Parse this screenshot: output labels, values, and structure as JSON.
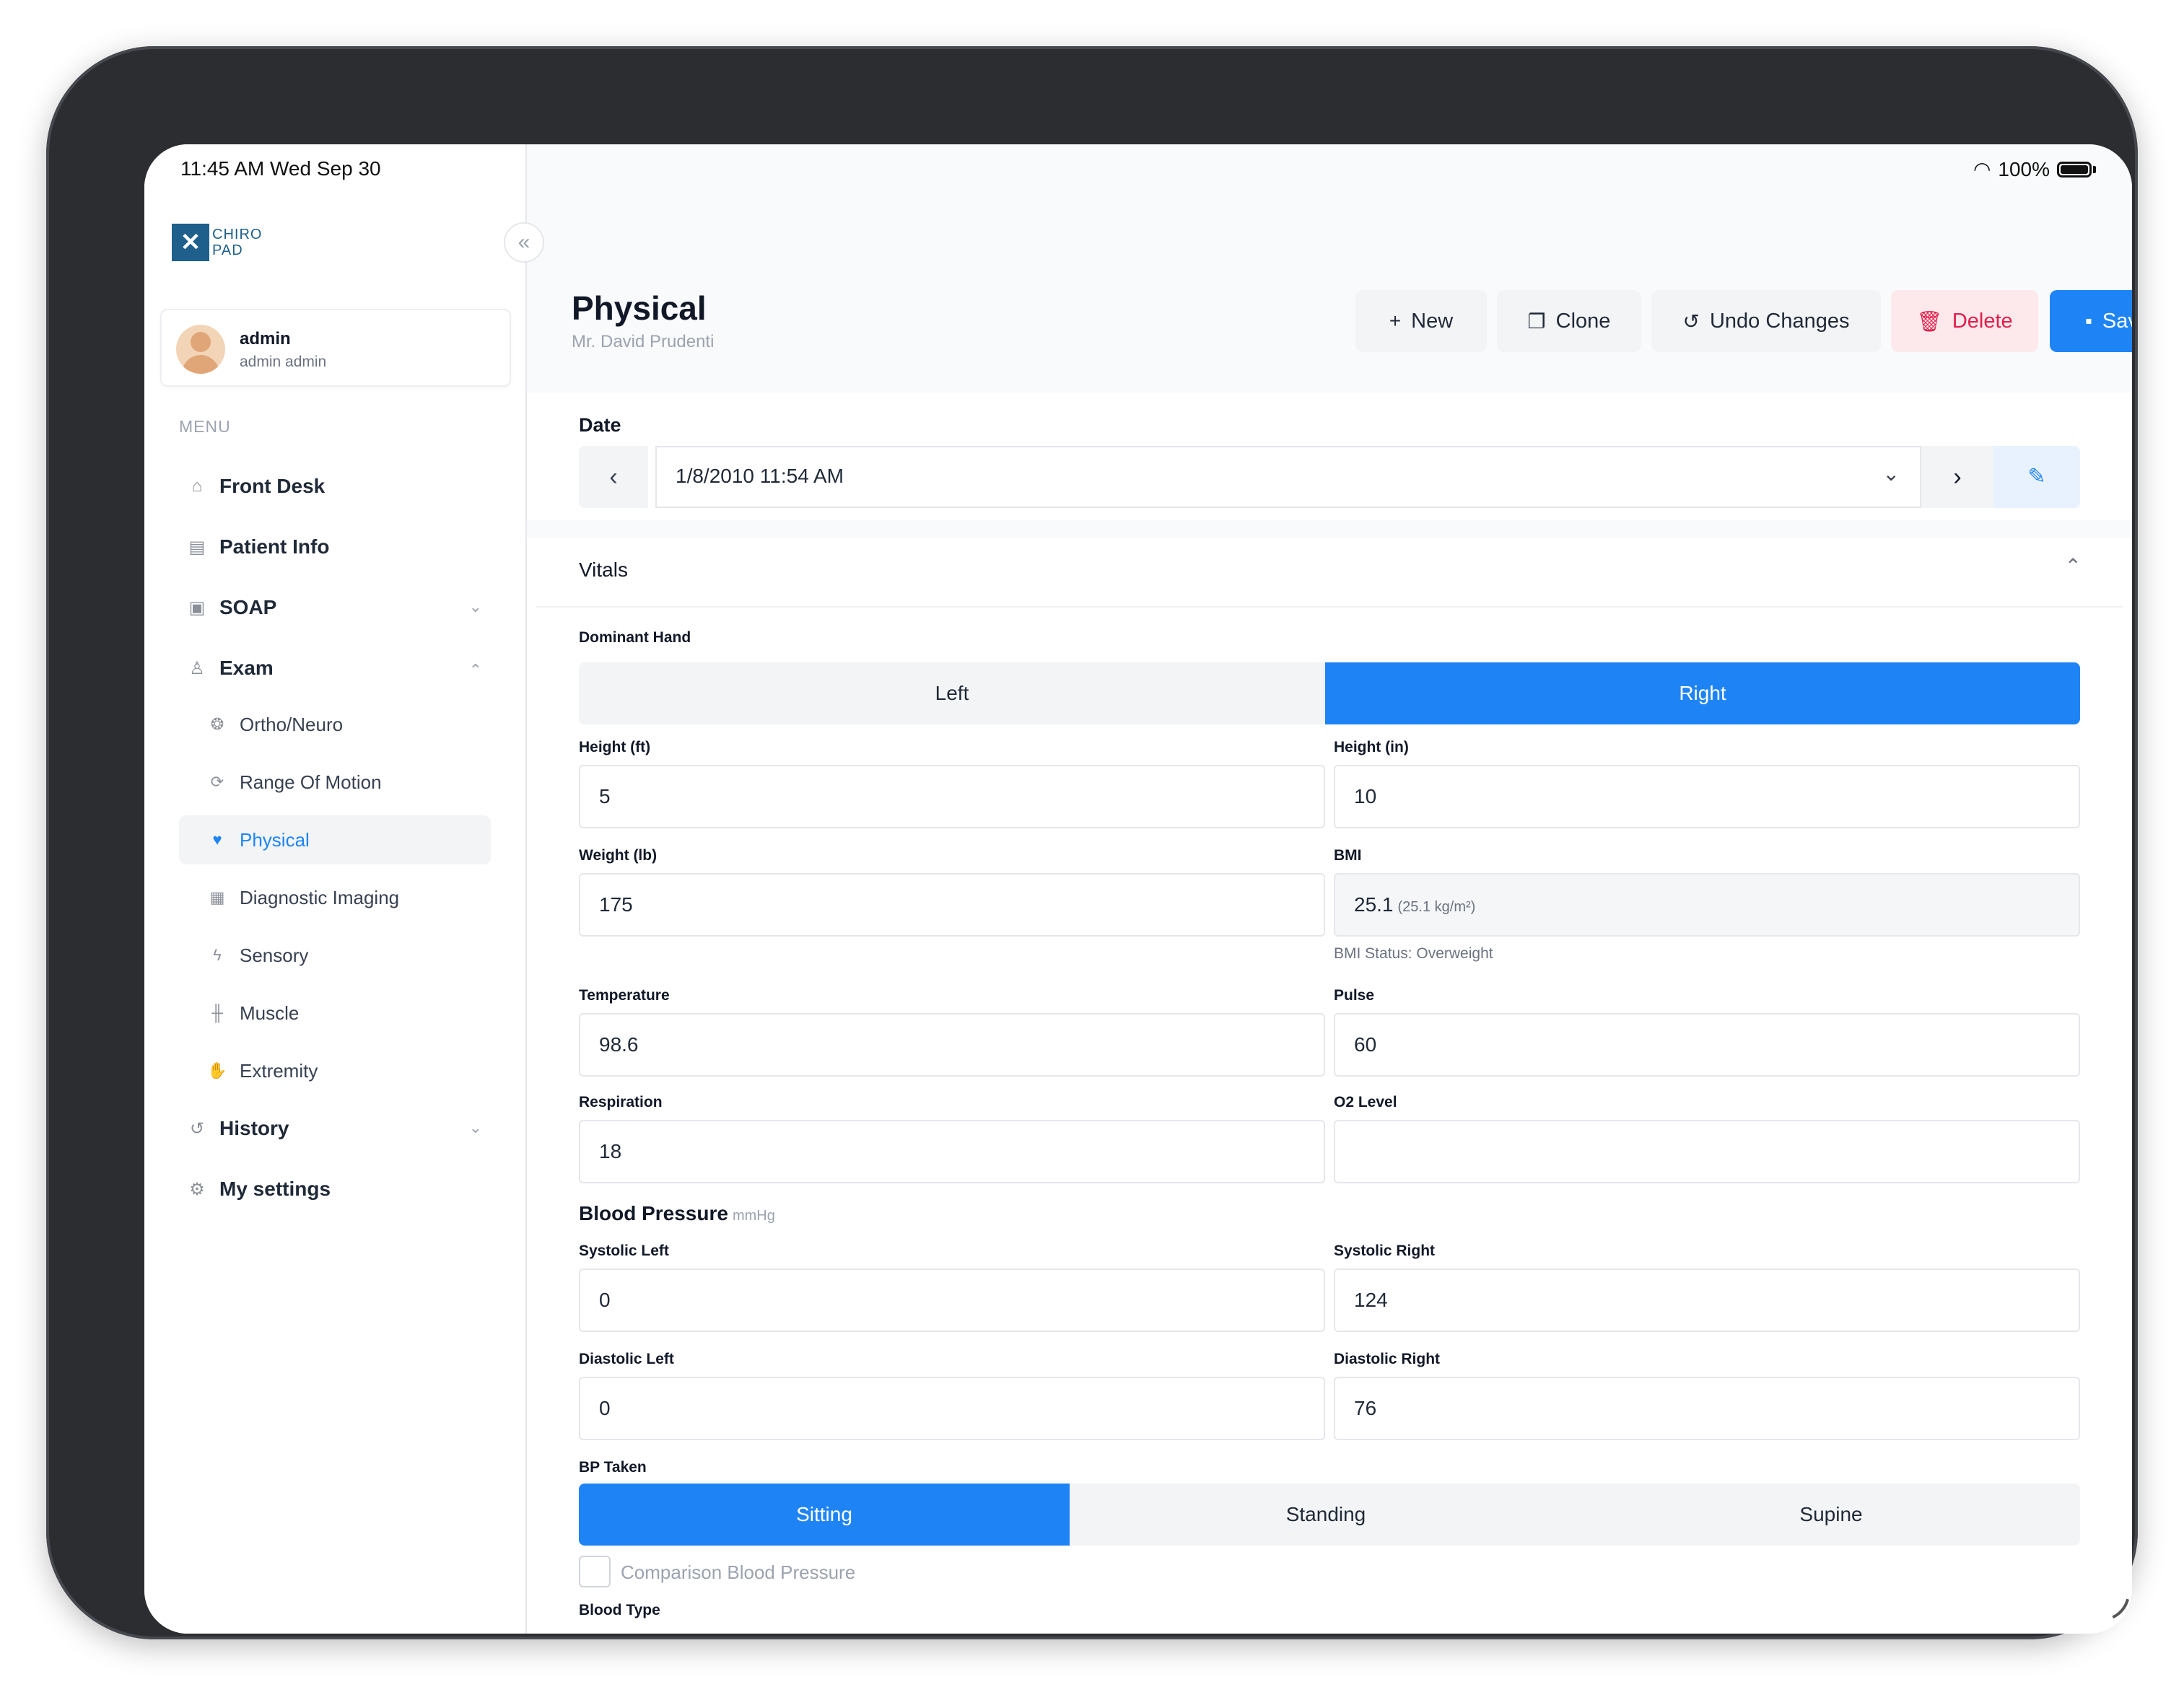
{
  "status_bar": {
    "time": "11:45 AM   Wed Sep 30",
    "battery": "100%"
  },
  "sidebar": {
    "logo_text_1": "CHIRO",
    "logo_text_2": "PAD",
    "collapse_glyph": "«",
    "user": {
      "name": "admin",
      "subtitle": "admin admin"
    },
    "menu_label": "MENU",
    "items": [
      {
        "label": "Front Desk",
        "icon": "home-icon"
      },
      {
        "label": "Patient Info",
        "icon": "id-card-icon"
      },
      {
        "label": "SOAP",
        "icon": "soap-icon"
      },
      {
        "label": "Exam",
        "icon": "person-icon"
      },
      {
        "label": "History",
        "icon": "history-icon"
      },
      {
        "label": "My settings",
        "icon": "gear-icon"
      }
    ],
    "exam_children": [
      {
        "label": "Ortho/Neuro",
        "icon": "brain-icon"
      },
      {
        "label": "Range Of Motion",
        "icon": "sync-icon"
      },
      {
        "label": "Physical",
        "icon": "heart-pulse-icon"
      },
      {
        "label": "Diagnostic Imaging",
        "icon": "xray-icon"
      },
      {
        "label": "Sensory",
        "icon": "bolt-icon"
      },
      {
        "label": "Muscle",
        "icon": "dumbbell-icon"
      },
      {
        "label": "Extremity",
        "icon": "hand-icon"
      }
    ]
  },
  "header": {
    "title": "Physical",
    "subtitle": "Mr. David Prudenti",
    "buttons": {
      "new": "New",
      "clone": "Clone",
      "undo": "Undo Changes",
      "delete": "Delete",
      "save": "Save"
    }
  },
  "date": {
    "label": "Date",
    "value": "1/8/2010 11:54 AM"
  },
  "vitals": {
    "title": "Vitals",
    "dominant_hand": {
      "label": "Dominant Hand",
      "options": [
        "Left",
        "Right"
      ],
      "selected": "Right"
    },
    "height_ft": {
      "label": "Height (ft)",
      "value": "5"
    },
    "height_in": {
      "label": "Height (in)",
      "value": "10"
    },
    "weight": {
      "label": "Weight (lb)",
      "value": "175"
    },
    "bmi": {
      "label": "BMI",
      "value": "25.1",
      "detail": "(25.1 kg/m²)",
      "status": "BMI Status: Overweight"
    },
    "temperature": {
      "label": "Temperature",
      "value": "98.6"
    },
    "pulse": {
      "label": "Pulse",
      "value": "60"
    },
    "respiration": {
      "label": "Respiration",
      "value": "18"
    },
    "o2": {
      "label": "O2 Level",
      "value": ""
    },
    "blood_pressure": {
      "title": "Blood Pressure",
      "unit": "mmHg",
      "systolic_left": {
        "label": "Systolic Left",
        "value": "0"
      },
      "systolic_right": {
        "label": "Systolic Right",
        "value": "124"
      },
      "diastolic_left": {
        "label": "Diastolic Left",
        "value": "0"
      },
      "diastolic_right": {
        "label": "Diastolic Right",
        "value": "76"
      }
    },
    "bp_taken": {
      "label": "BP Taken",
      "options": [
        "Sitting",
        "Standing",
        "Supine"
      ],
      "selected": "Sitting"
    },
    "comparison_bp": {
      "label": "Comparison Blood Pressure",
      "checked": false
    },
    "blood_type": {
      "label": "Blood Type"
    }
  },
  "colors": {
    "accent": "#1e84f5",
    "danger": "#e11d48",
    "danger_bg": "#fde8ec"
  }
}
